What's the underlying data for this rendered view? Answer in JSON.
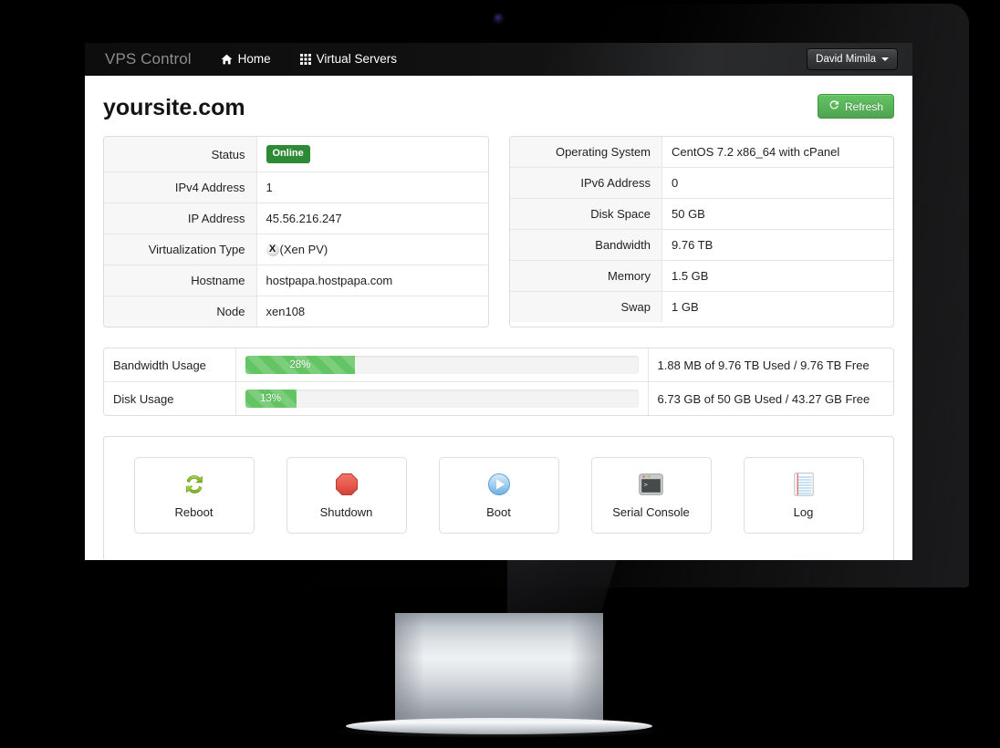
{
  "navbar": {
    "brand": "VPS Control",
    "links": [
      {
        "label": "Home",
        "icon": "home-icon"
      },
      {
        "label": "Virtual Servers",
        "icon": "grid-icon"
      }
    ],
    "user": {
      "name": "David Mimila",
      "caret": "chevron-down-icon"
    }
  },
  "page": {
    "title": "yoursite.com",
    "refresh_label": "Refresh",
    "refresh_icon": "refresh-icon",
    "refresh_color": "#51a351"
  },
  "left_table": {
    "rows": [
      {
        "label": "Status",
        "value": "Online",
        "type": "badge",
        "badge_color": "#2f8a36"
      },
      {
        "label": "IPv4 Address",
        "value": "1",
        "type": "text"
      },
      {
        "label": "IP Address",
        "value": "45.56.216.247",
        "type": "text"
      },
      {
        "label": "Virtualization Type",
        "value": "(Xen PV)",
        "type": "xen",
        "icon": "xen-logo-icon"
      },
      {
        "label": "Hostname",
        "value": "hostpapa.hostpapa.com",
        "type": "text"
      },
      {
        "label": "Node",
        "value": "xen108",
        "type": "text"
      }
    ]
  },
  "right_table": {
    "rows": [
      {
        "label": "Operating System",
        "value": "CentOS 7.2 x86_64 with cPanel"
      },
      {
        "label": "IPv6 Address",
        "value": "0"
      },
      {
        "label": "Disk Space",
        "value": "50 GB"
      },
      {
        "label": "Bandwidth",
        "value": "9.76 TB"
      },
      {
        "label": "Memory",
        "value": "1.5 GB"
      },
      {
        "label": "Swap",
        "value": "1 GB"
      }
    ]
  },
  "usage": {
    "bar_color": "#62c462",
    "rows": [
      {
        "label": "Bandwidth Usage",
        "percent_label": "28%",
        "percent": 28,
        "detail": "1.88 MB of 9.76 TB Used / 9.76 TB Free"
      },
      {
        "label": "Disk Usage",
        "percent_label": "13%",
        "percent": 13,
        "detail": "6.73 GB of 50 GB Used / 43.27 GB Free"
      }
    ]
  },
  "actions": [
    {
      "label": "Reboot",
      "icon": "reboot-icon"
    },
    {
      "label": "Shutdown",
      "icon": "shutdown-icon"
    },
    {
      "label": "Boot",
      "icon": "boot-play-icon"
    },
    {
      "label": "Serial Console",
      "icon": "terminal-icon"
    },
    {
      "label": "Log",
      "icon": "log-notebook-icon"
    }
  ]
}
